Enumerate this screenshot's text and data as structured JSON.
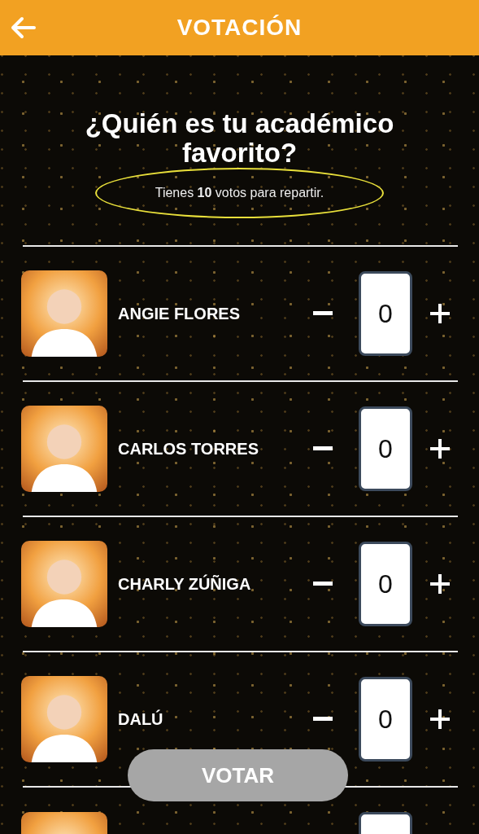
{
  "header": {
    "title": "VOTACIÓN"
  },
  "question": "¿Quién es tu académico favorito?",
  "subtitle": "Tienes **10** votos para repartir.",
  "candidates": [
    {
      "name": "ANGIE FLORES",
      "votes": "0"
    },
    {
      "name": "CARLOS TORRES",
      "votes": "0"
    },
    {
      "name": "CHARLY ZÚÑIGA",
      "votes": "0"
    },
    {
      "name": "DALÚ",
      "votes": "0"
    }
  ],
  "vote_button": "VOTAR"
}
